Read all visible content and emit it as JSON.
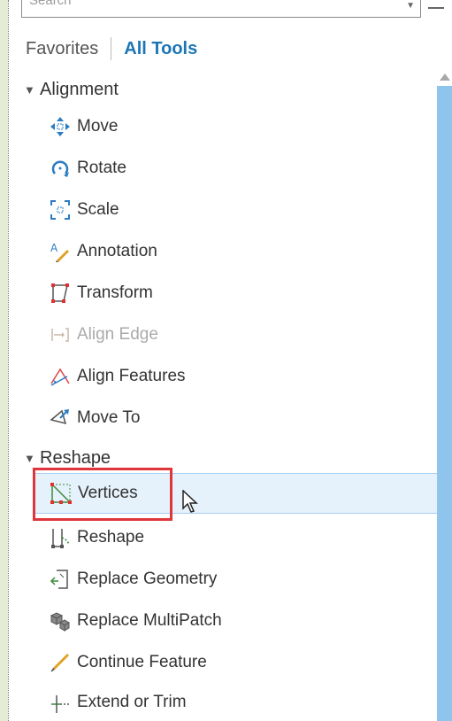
{
  "search": {
    "placeholder": "Search"
  },
  "tabs": {
    "favorites": "Favorites",
    "all_tools": "All Tools"
  },
  "groups": [
    {
      "label": "Alignment",
      "items": [
        {
          "label": "Move",
          "icon": "move-icon"
        },
        {
          "label": "Rotate",
          "icon": "rotate-icon"
        },
        {
          "label": "Scale",
          "icon": "scale-icon"
        },
        {
          "label": "Annotation",
          "icon": "annotation-icon"
        },
        {
          "label": "Transform",
          "icon": "transform-icon"
        },
        {
          "label": "Align Edge",
          "icon": "align-edge-icon",
          "disabled": true
        },
        {
          "label": "Align Features",
          "icon": "align-features-icon"
        },
        {
          "label": "Move To",
          "icon": "move-to-icon"
        }
      ]
    },
    {
      "label": "Reshape",
      "items": [
        {
          "label": "Vertices",
          "icon": "vertices-icon",
          "selected": true
        },
        {
          "label": "Reshape",
          "icon": "reshape-icon"
        },
        {
          "label": "Replace Geometry",
          "icon": "replace-geometry-icon"
        },
        {
          "label": "Replace MultiPatch",
          "icon": "replace-multipatch-icon"
        },
        {
          "label": "Continue Feature",
          "icon": "continue-feature-icon"
        },
        {
          "label": "Extend or Trim",
          "icon": "extend-trim-icon"
        }
      ]
    }
  ],
  "colors": {
    "accent": "#1c76b6",
    "selection_bg": "#e5f1fb",
    "highlight_box": "#e0353a",
    "scroll_thumb": "#8fc4ec"
  }
}
